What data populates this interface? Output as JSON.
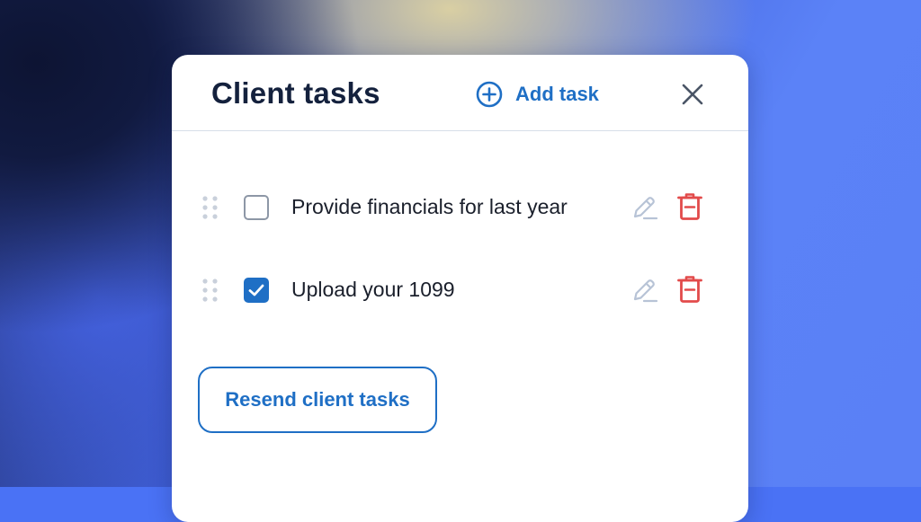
{
  "panel": {
    "title": "Client tasks",
    "add_task_label": "Add task",
    "close_icon": "close-icon",
    "add_icon": "plus-circle-icon"
  },
  "tasks": [
    {
      "label": "Provide financials for last year",
      "checked": false
    },
    {
      "label": "Upload your 1099",
      "checked": true
    }
  ],
  "actions": {
    "resend_label": "Resend client tasks"
  },
  "colors": {
    "accent": "#1f6fc5",
    "delete": "#e24b4b",
    "edit": "#b7c3d6",
    "text": "#14213d"
  }
}
